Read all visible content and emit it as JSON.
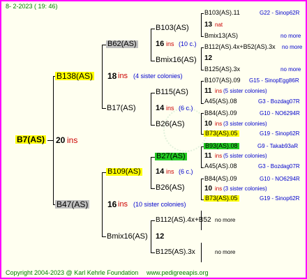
{
  "header": {
    "date": "8-  2-2023 ( 19: 46)"
  },
  "footer": {
    "copyright": "Copyright 2004-2023 @ Karl Kehrle Foundation",
    "site": "www.pedigreeapis.org"
  },
  "root": {
    "name": "B7(AS)",
    "ins_num": "20",
    "ins_word": "ins"
  },
  "gen1": {
    "sire": {
      "name": "B138(AS)",
      "ins_num": "18",
      "ins_word": "ins",
      "note": "(4 sister colonies)"
    },
    "dam": {
      "name": "B47(AS)",
      "ins_num": "16",
      "ins_word": "ins",
      "note": "(10 sister colonies)"
    }
  },
  "gen2": {
    "b62": {
      "name": "B62(AS)"
    },
    "b17": {
      "name": "B17(AS)",
      "ins_num": "14",
      "ins_word": "ins",
      "note": "(6 c.)"
    },
    "b109": {
      "name": "B109(AS)",
      "ins_num": "14",
      "ins_word": "ins",
      "note": "(6 c.)"
    },
    "bmix16": {
      "name": "Bmix16(AS)",
      "ins_num": "12"
    }
  },
  "gen3": {
    "b103": {
      "name": "B103(AS)",
      "ins_num": "16",
      "ins_word": "ins",
      "note": "(10 c.)"
    },
    "bmix16b": {
      "name": "Bmix16(AS)",
      "ins_num": "12"
    },
    "b115": {
      "name": "B115(AS)"
    },
    "b26a": {
      "name": "B26(AS)"
    },
    "b27": {
      "name": "B27(AS)"
    },
    "b26b": {
      "name": "B26(AS)"
    },
    "b112": {
      "name": "B112(AS).4x+B52",
      "note": "no more"
    },
    "b125": {
      "name": "B125(AS).3x",
      "note": "no more"
    }
  },
  "gen4": [
    {
      "name": "B103(AS).11",
      "info": "G22 - Sinop62R",
      "info_color": "blue"
    },
    {
      "name": "13",
      "extra": "nat",
      "info": "",
      "info_color": "red"
    },
    {
      "name": "Bmix13(AS)",
      "info": "no more",
      "info_color": "blue"
    },
    {
      "name": "B112(AS).4x+B52(AS).3x",
      "info": "no more",
      "info_color": "blue"
    },
    {
      "name": "12",
      "info": "",
      "info_color": "blue"
    },
    {
      "name": "B125(AS).3x",
      "info": "no more",
      "info_color": "blue"
    },
    {
      "name": "B107(AS).09",
      "info": "G15 - SinopEgg86R",
      "info_color": "blue"
    },
    {
      "name": "11",
      "extra": "ins",
      "note": "(5 sister colonies)",
      "info_color": "red"
    },
    {
      "name": "A45(AS).08",
      "info": "G3 - Bozdag07R",
      "info_color": "blue"
    },
    {
      "name": "B84(AS).09",
      "info": "G10 - NO6294R",
      "info_color": "blue"
    },
    {
      "name": "10",
      "extra": "ins",
      "note": "(3 sister colonies)",
      "info_color": "red"
    },
    {
      "name": "B73(AS).05",
      "info": "G19 - Sinop62R",
      "info_color": "blue"
    },
    {
      "name": "B93(AS).08",
      "info": "G9 - Takab93aR",
      "info_color": "blue"
    },
    {
      "name": "11",
      "extra": "ins",
      "note": "(5 sister colonies)",
      "info_color": "red"
    },
    {
      "name": "A45(AS).08",
      "info": "G3 - Bozdag07R",
      "info_color": "blue"
    },
    {
      "name": "B84(AS).09",
      "info": "G10 - NO6294R",
      "info_color": "blue"
    },
    {
      "name": "10",
      "extra": "ins",
      "note": "(3 sister colonies)",
      "info_color": "red"
    },
    {
      "name": "B73(AS).05",
      "info": "G19 - Sinop62R",
      "info_color": "blue"
    }
  ],
  "colors": {
    "border": "#ff00ff",
    "background": "#fffff0",
    "highlight_yellow": "#ffff00",
    "highlight_grey": "#c0c0c0",
    "highlight_green": "#22cc22",
    "ins_red": "#cc0000",
    "info_blue": "#0000cc",
    "footer_green": "#008000"
  }
}
